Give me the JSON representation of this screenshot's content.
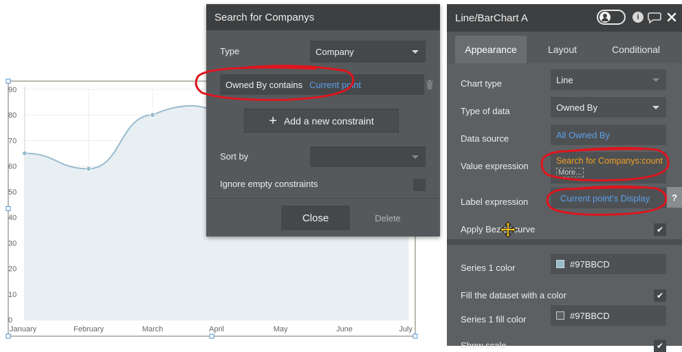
{
  "chart_data": {
    "type": "line",
    "categories": [
      "January",
      "February",
      "March",
      "April",
      "May",
      "June",
      "July"
    ],
    "x_plotted": [
      "January",
      "February",
      "March"
    ],
    "values": [
      65,
      59,
      80
    ],
    "ylim": [
      0,
      90
    ],
    "yticks": [
      0,
      10,
      20,
      30,
      40,
      50,
      60,
      70,
      80,
      90
    ],
    "curve": "bezier",
    "fill": true,
    "color": "#97BBCD",
    "grid": true
  },
  "search_popup": {
    "title": "Search for Companys",
    "type_label": "Type",
    "type_value": "Company",
    "constraint_field": "Owned By contains",
    "constraint_value": "Current point",
    "add_constraint_label": "Add a new constraint",
    "sort_label": "Sort by",
    "sort_value": "",
    "ignore_label": "Ignore empty constraints",
    "close_label": "Close",
    "delete_label": "Delete"
  },
  "prop_panel": {
    "title": "Line/BarChart A",
    "tabs": [
      {
        "label": "Appearance"
      },
      {
        "label": "Layout"
      },
      {
        "label": "Conditional"
      }
    ],
    "chart_type_label": "Chart type",
    "chart_type_value": "Line",
    "type_of_data_label": "Type of data",
    "type_of_data_value": "Owned By",
    "data_source_label": "Data source",
    "data_source_value": "All Owned By",
    "value_expression_label": "Value expression",
    "value_expression_value": "Search for Companys:count",
    "value_expression_more": "More...",
    "label_expression_label": "Label expression",
    "label_expression_value": "Current point's Display",
    "bezier_label": "Apply Bezier curve",
    "bezier_checked": "✔",
    "series1_color_label": "Series 1 color",
    "series1_color_value": "#97BBCD",
    "fill_dataset_label": "Fill the dataset with a color",
    "fill_dataset_checked": "✔",
    "series1_fill_label": "Series 1 fill color",
    "series1_fill_value": "#97BBCD",
    "show_scale_label": "Show scale",
    "show_scale_checked": "✔",
    "help_label": "?"
  },
  "colors": {
    "series": "#97BBCD",
    "fill": "#E8EFF3",
    "annotation": "#E0141E",
    "link": "#5AA0E8",
    "expression": "#F0A024"
  }
}
